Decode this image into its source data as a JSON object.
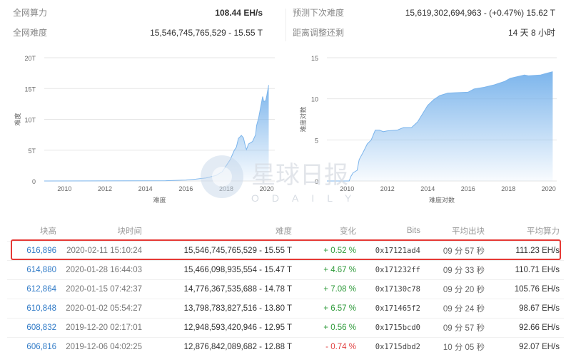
{
  "stats": {
    "hashrate": {
      "label": "全网算力",
      "value": "108.44 EH/s"
    },
    "difficulty": {
      "label": "全网难度",
      "value": "15,546,745,765,529 - 15.55 T"
    },
    "next_difficulty": {
      "label": "预测下次难度",
      "value": "15,619,302,694,963 - (+0.47%) 15.62 T"
    },
    "time_to_adjust": {
      "label": "距离调整还剩",
      "value": "14 天 8 小时"
    }
  },
  "chart_data": [
    {
      "type": "area",
      "xlabel": "难度",
      "ylabel": "难度",
      "yticks": [
        "0",
        "5T",
        "10T",
        "15T",
        "20T"
      ],
      "ylim": [
        0,
        20
      ],
      "xlim": [
        2009,
        2020.4
      ],
      "xticks": [
        "2010",
        "2012",
        "2014",
        "2016",
        "2018",
        "2020"
      ],
      "grid": true,
      "color": "#7cb5ec",
      "x": [
        2009,
        2015,
        2016,
        2016.5,
        2017,
        2017.5,
        2017.8,
        2018,
        2018.2,
        2018.4,
        2018.5,
        2018.6,
        2018.75,
        2018.85,
        2018.95,
        2019.0,
        2019.1,
        2019.3,
        2019.45,
        2019.5,
        2019.6,
        2019.7,
        2019.8,
        2019.85,
        2019.95,
        2020.0,
        2020.05,
        2020.1
      ],
      "y": [
        0,
        0.05,
        0.15,
        0.3,
        0.5,
        0.9,
        1.5,
        2.5,
        3.5,
        5,
        5.5,
        6.9,
        7.4,
        7,
        5.6,
        5.1,
        6,
        6.4,
        7.5,
        9,
        10.2,
        12,
        13.7,
        12.9,
        13,
        13.8,
        14.7,
        15.55
      ]
    },
    {
      "type": "area",
      "xlabel": "难度对数",
      "ylabel": "难度对数",
      "yticks": [
        "0",
        "5",
        "10",
        "15"
      ],
      "ylim": [
        0,
        15
      ],
      "xlim": [
        2009,
        2020.4
      ],
      "xticks": [
        "2010",
        "2012",
        "2014",
        "2016",
        "2018",
        "2020"
      ],
      "grid": true,
      "color": "#7cb5ec",
      "x": [
        2009,
        2010.1,
        2010.2,
        2010.3,
        2010.5,
        2010.6,
        2010.8,
        2011,
        2011.2,
        2011.4,
        2011.6,
        2011.8,
        2012,
        2012.5,
        2012.8,
        2013.2,
        2013.5,
        2013.8,
        2014,
        2014.3,
        2014.6,
        2015,
        2016,
        2016.3,
        2016.8,
        2017.3,
        2017.8,
        2018.1,
        2018.8,
        2019,
        2019.6,
        2020.2
      ],
      "y": [
        0,
        0,
        0.6,
        1,
        1.3,
        2.6,
        3.5,
        4.5,
        5,
        6.2,
        6.2,
        6,
        6.1,
        6.2,
        6.5,
        6.5,
        7.2,
        8.4,
        9.2,
        9.9,
        10.4,
        10.7,
        10.8,
        11.2,
        11.4,
        11.7,
        12.1,
        12.5,
        12.9,
        12.8,
        12.9,
        13.3
      ]
    }
  ],
  "table": {
    "headers": [
      "块高",
      "块时间",
      "难度",
      "变化",
      "Bits",
      "平均出块",
      "平均算力"
    ],
    "rows": [
      [
        "616,896",
        "2020-02-11 15:10:24",
        "15,546,745,765,529 - 15.55 T",
        "+ 0.52 %",
        "0x17121ad4",
        "09 分 57 秒",
        "111.23 EH/s"
      ],
      [
        "614,880",
        "2020-01-28 16:44:03",
        "15,466,098,935,554 - 15.47 T",
        "+ 4.67 %",
        "0x171232ff",
        "09 分 33 秒",
        "110.71 EH/s"
      ],
      [
        "612,864",
        "2020-01-15 07:42:37",
        "14,776,367,535,688 - 14.78 T",
        "+ 7.08 %",
        "0x17130c78",
        "09 分 20 秒",
        "105.76 EH/s"
      ],
      [
        "610,848",
        "2020-01-02 05:54:27",
        "13,798,783,827,516 - 13.80 T",
        "+ 6.57 %",
        "0x171465f2",
        "09 分 24 秒",
        "98.67 EH/s"
      ],
      [
        "608,832",
        "2019-12-20 02:17:01",
        "12,948,593,420,946 - 12.95 T",
        "+ 0.56 %",
        "0x1715bcd0",
        "09 分 57 秒",
        "92.66 EH/s"
      ],
      [
        "606,816",
        "2019-12-06 04:02:25",
        "12,876,842,089,682 - 12.88 T",
        "- 0.74 %",
        "0x1715dbd2",
        "10 分 05 秒",
        "92.07 EH/s"
      ]
    ],
    "highlighted_row": 0
  },
  "watermark": {
    "text": "星球日报",
    "sub": "ODAILY"
  }
}
